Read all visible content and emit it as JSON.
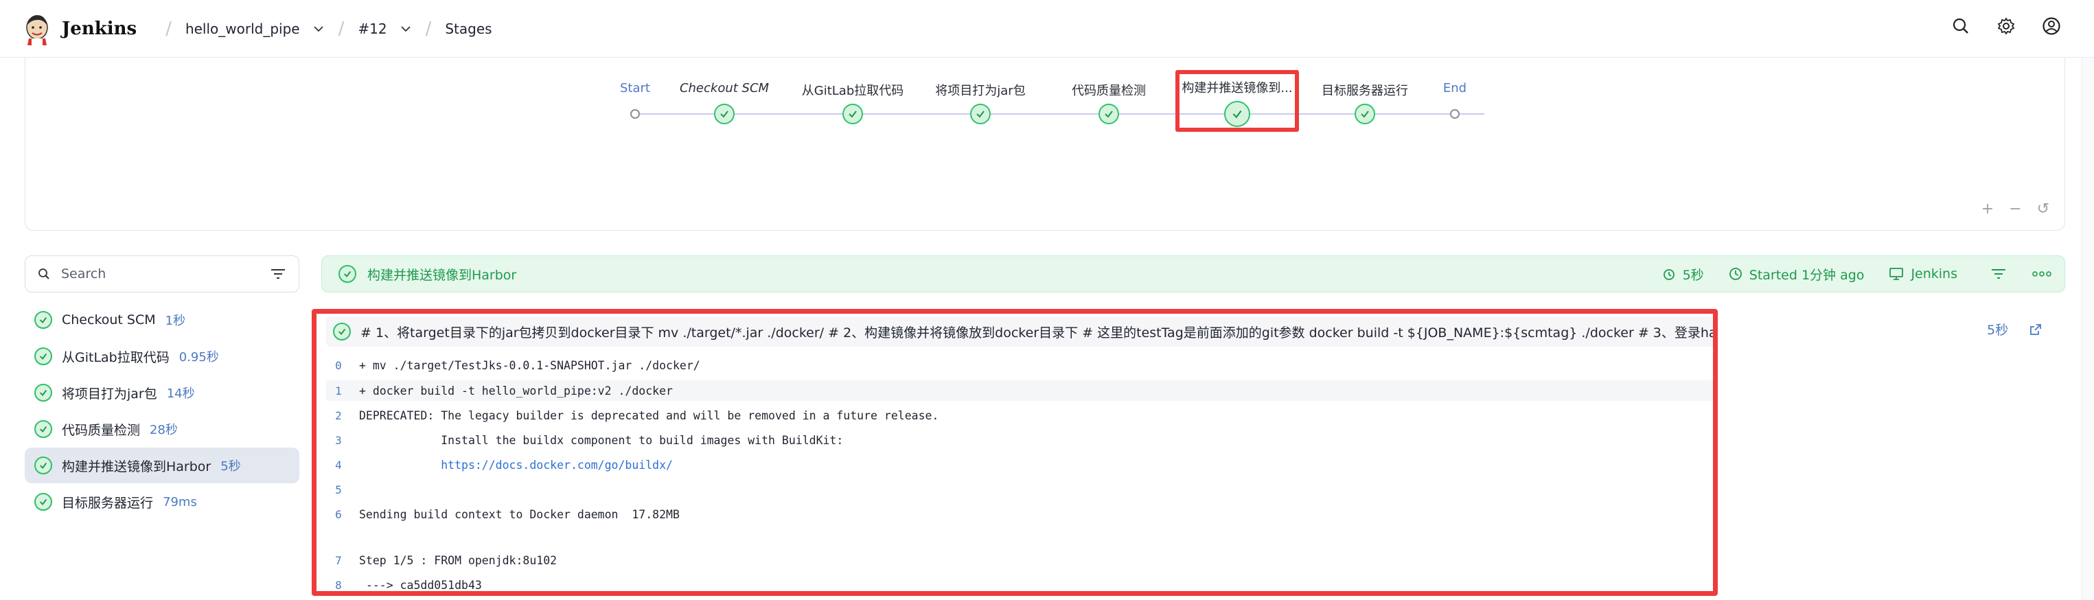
{
  "header": {
    "brand": "Jenkins",
    "breadcrumbs": [
      {
        "label": "hello_world_pipe",
        "has_dropdown": true
      },
      {
        "label": "#12",
        "has_dropdown": true
      },
      {
        "label": "Stages",
        "has_dropdown": false
      }
    ],
    "icons": [
      "search-icon",
      "gear-icon",
      "user-icon"
    ]
  },
  "graph": {
    "stages": [
      {
        "label": "Start",
        "type": "start"
      },
      {
        "label": "Checkout SCM",
        "type": "success",
        "italic": true
      },
      {
        "label": "从GitLab拉取代码",
        "type": "success"
      },
      {
        "label": "将项目打为jar包",
        "type": "success"
      },
      {
        "label": "代码质量检测",
        "type": "success"
      },
      {
        "label": "构建并推送镜像到...",
        "type": "success",
        "selected": true
      },
      {
        "label": "目标服务器运行",
        "type": "success"
      },
      {
        "label": "End",
        "type": "end"
      }
    ],
    "zoom_controls": [
      "+",
      "−",
      "↺"
    ]
  },
  "sidebar": {
    "search_placeholder": "Search",
    "items": [
      {
        "label": "Checkout SCM",
        "duration": "1秒",
        "active": false
      },
      {
        "label": "从GitLab拉取代码",
        "duration": "0.95秒",
        "active": false
      },
      {
        "label": "将项目打为jar包",
        "duration": "14秒",
        "active": false
      },
      {
        "label": "代码质量检测",
        "duration": "28秒",
        "active": false
      },
      {
        "label": "构建并推送镜像到Harbor",
        "duration": "5秒",
        "active": true
      },
      {
        "label": "目标服务器运行",
        "duration": "79ms",
        "active": false
      }
    ]
  },
  "stage_header": {
    "title": "构建并推送镜像到Harbor",
    "duration": "5秒",
    "started": "Started 1分钟 ago",
    "agent": "Jenkins",
    "colors": {
      "success": "#1d9a4d",
      "bg": "#e6f7ec"
    }
  },
  "log": {
    "step_command": "# 1、将target目录下的jar包拷贝到docker目录下 mv ./target/*.jar ./docker/ # 2、构建镜像并将镜像放到docker目录下 # 这里的testTag是前面添加的git参数 docker build -t ${JOB_NAME}:${scmtag} ./docker # 3、登录harbo...",
    "step_duration": "5秒",
    "lines": [
      {
        "n": "0",
        "text": "+ mv ./target/TestJks-0.0.1-SNAPSHOT.jar ./docker/"
      },
      {
        "n": "1",
        "text": "+ docker build -t hello_world_pipe:v2 ./docker"
      },
      {
        "n": "2",
        "text": "DEPRECATED: The legacy builder is deprecated and will be removed in a future release."
      },
      {
        "n": "3",
        "text": "            Install the buildx component to build images with BuildKit:"
      },
      {
        "n": "4",
        "text": "            https://docs.docker.com/go/buildx/"
      },
      {
        "n": "5",
        "text": ""
      },
      {
        "n": "6",
        "text": "Sending build context to Docker daemon  17.82MB"
      },
      {
        "n": "7",
        "text": "Step 1/5 : FROM openjdk:8u102"
      },
      {
        "n": "8",
        "text": " ---> ca5dd051db43"
      }
    ]
  }
}
